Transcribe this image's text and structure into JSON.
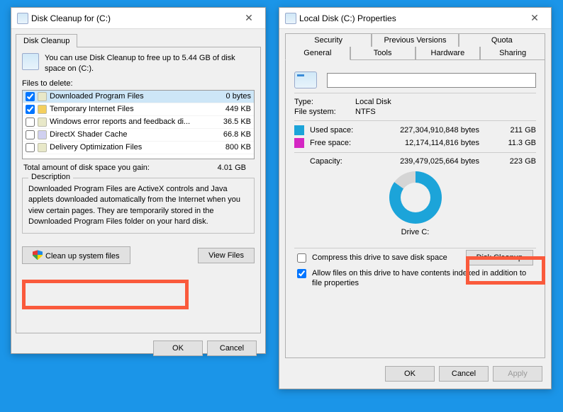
{
  "dlg1": {
    "title": "Disk Cleanup for  (C:)",
    "tab": "Disk Cleanup",
    "intro": "You can use Disk Cleanup to free up to 5.44 GB of disk space on  (C:).",
    "files_label": "Files to delete:",
    "rows": [
      {
        "name": "Downloaded Program Files",
        "size": "0 bytes",
        "checked": true
      },
      {
        "name": "Temporary Internet Files",
        "size": "449 KB",
        "checked": true
      },
      {
        "name": "Windows error reports and feedback di...",
        "size": "36.5 KB",
        "checked": false
      },
      {
        "name": "DirectX Shader Cache",
        "size": "66.8 KB",
        "checked": false
      },
      {
        "name": "Delivery Optimization Files",
        "size": "800 KB",
        "checked": false
      }
    ],
    "total_label": "Total amount of disk space you gain:",
    "total_value": "4.01 GB",
    "desc_legend": "Description",
    "desc_text": "Downloaded Program Files are ActiveX controls and Java applets downloaded automatically from the Internet when you view certain pages. They are temporarily stored in the Downloaded Program Files folder on your hard disk.",
    "cleanup_btn": "Clean up system files",
    "viewfiles_btn": "View Files",
    "ok": "OK",
    "cancel": "Cancel"
  },
  "dlg2": {
    "title": "Local Disk (C:) Properties",
    "tabs_top": [
      "Security",
      "Previous Versions",
      "Quota"
    ],
    "tabs_bottom": [
      "General",
      "Tools",
      "Hardware",
      "Sharing"
    ],
    "type_label": "Type:",
    "type_value": "Local Disk",
    "fs_label": "File system:",
    "fs_value": "NTFS",
    "used_label": "Used space:",
    "used_bytes": "227,304,910,848 bytes",
    "used_gb": "211 GB",
    "free_label": "Free space:",
    "free_bytes": "12,174,114,816 bytes",
    "free_gb": "11.3 GB",
    "cap_label": "Capacity:",
    "cap_bytes": "239,479,025,664 bytes",
    "cap_gb": "223 GB",
    "drive_label": "Drive C:",
    "diskcleanup_btn": "Disk Cleanup",
    "compress_label": "Compress this drive to save disk space",
    "allow_label": "Allow files on this drive to have contents indexed in addition to file properties",
    "ok": "OK",
    "cancel": "Cancel",
    "apply": "Apply"
  }
}
